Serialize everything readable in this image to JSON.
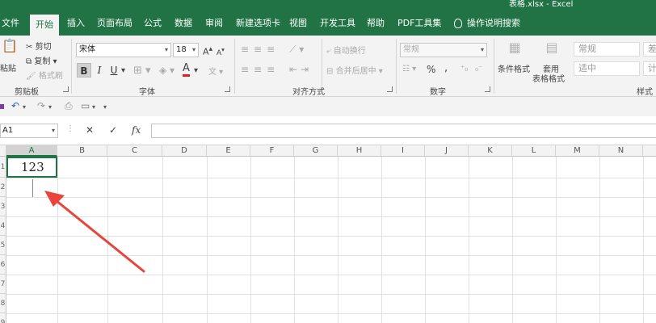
{
  "window": {
    "title": "表格.xlsx  -  Excel"
  },
  "tabs": [
    {
      "label": "文件"
    },
    {
      "label": "开始"
    },
    {
      "label": "插入"
    },
    {
      "label": "页面布局"
    },
    {
      "label": "公式"
    },
    {
      "label": "数据"
    },
    {
      "label": "审阅"
    },
    {
      "label": "新建选项卡"
    },
    {
      "label": "视图"
    },
    {
      "label": "开发工具"
    },
    {
      "label": "帮助"
    },
    {
      "label": "PDF工具集"
    },
    {
      "label": "操作说明搜索"
    }
  ],
  "ribbon": {
    "clipboard": {
      "paste": "粘贴",
      "cut": "剪切",
      "copy": "复制",
      "format_painter": "格式刷",
      "label": "剪贴板"
    },
    "font": {
      "name": "宋体",
      "size": "18",
      "grow": "A",
      "shrink": "A",
      "bold": "B",
      "italic": "I",
      "underline": "U",
      "font_color_glyph": "A",
      "phonetic": "文",
      "label": "字体"
    },
    "alignment": {
      "wrap": "自动换行",
      "merge": "合并后居中",
      "label": "对齐方式"
    },
    "number": {
      "format": "常规",
      "percent": "%",
      "comma": ",",
      "label": "数字"
    },
    "styles": {
      "conditional": "条件格式",
      "table_1": "套用",
      "table_2": "表格格式",
      "cell_normal": "常规",
      "cell_neutral": "适中",
      "cell_bad": "差",
      "cell_calc": "计",
      "label": "样式"
    }
  },
  "qat": {
    "undo": "↶",
    "redo": "↷"
  },
  "formula_bar": {
    "name_box": "A1",
    "cancel": "✕",
    "enter": "✓",
    "fx": "fx",
    "value": ""
  },
  "grid": {
    "columns": [
      "A",
      "B",
      "C",
      "D",
      "E",
      "F",
      "G",
      "H",
      "I",
      "J",
      "K",
      "L",
      "M",
      "N"
    ],
    "rows": [
      "1",
      "2",
      "3",
      "4",
      "5",
      "6",
      "7",
      "8",
      "9"
    ],
    "a1_value": "123"
  },
  "colors": {
    "accent": "#217346",
    "arrow": "#e8453c"
  }
}
